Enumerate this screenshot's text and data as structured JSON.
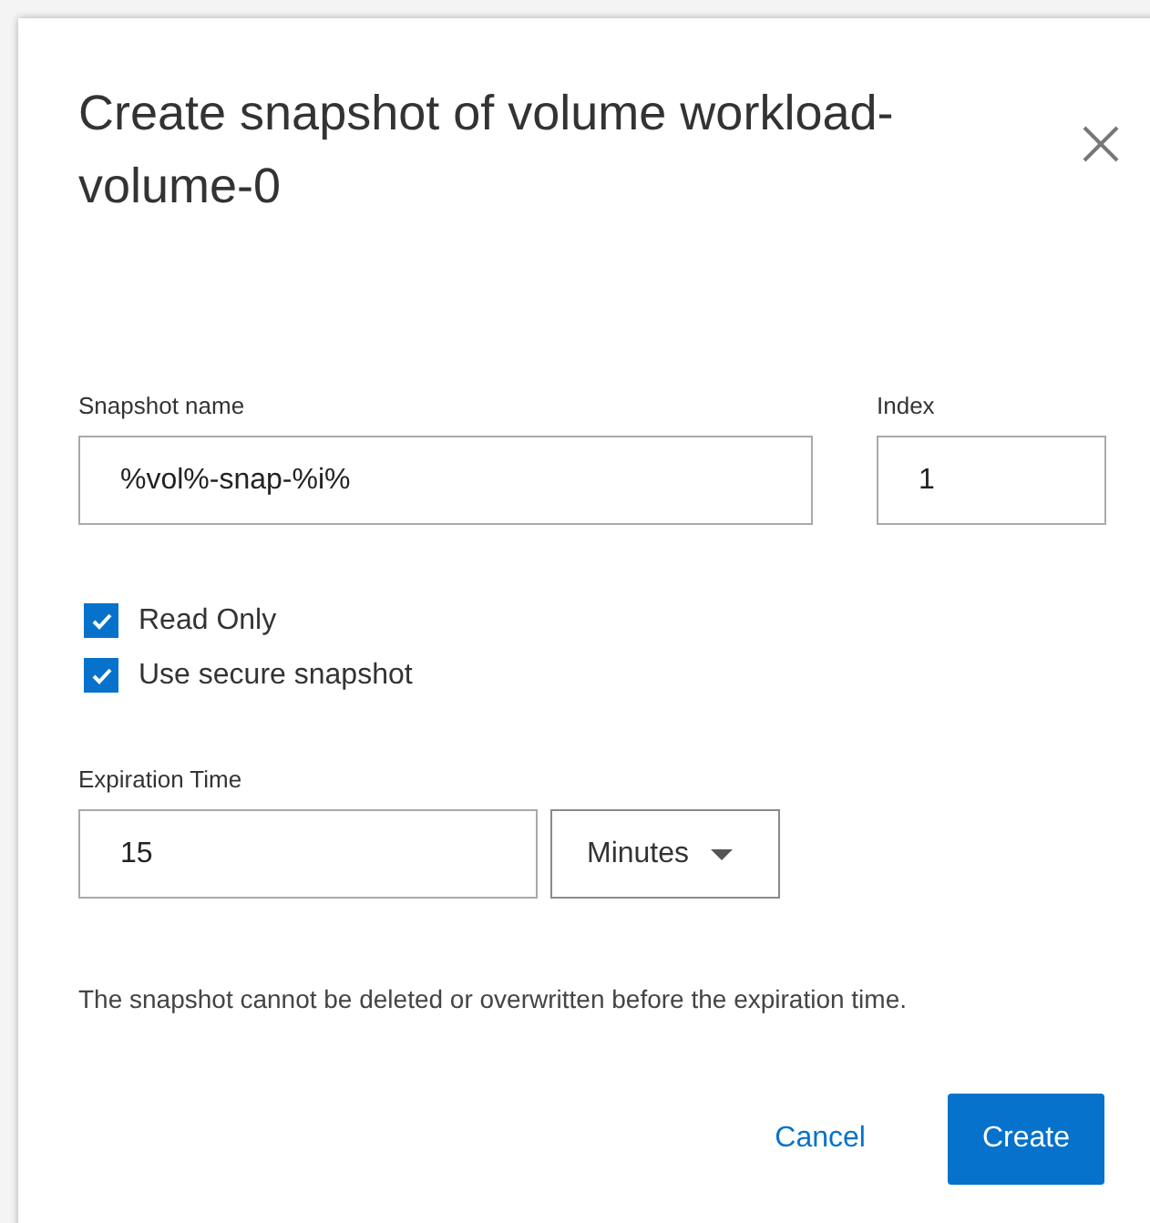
{
  "dialog": {
    "title": "Create snapshot of volume workload-volume-0"
  },
  "snapshot_name": {
    "label": "Snapshot name",
    "value": "%vol%-snap-%i%"
  },
  "index": {
    "label": "Index",
    "value": "1"
  },
  "options": [
    {
      "label": "Read Only",
      "checked": true
    },
    {
      "label": "Use secure snapshot",
      "checked": true
    }
  ],
  "expiration": {
    "label": "Expiration Time",
    "value": "15",
    "unit": "Minutes"
  },
  "note": "The snapshot cannot be deleted or overwritten before the expiration time.",
  "buttons": [
    {
      "label": "Cancel",
      "kind": "link"
    },
    {
      "label": "Create",
      "kind": "primary"
    }
  ]
}
